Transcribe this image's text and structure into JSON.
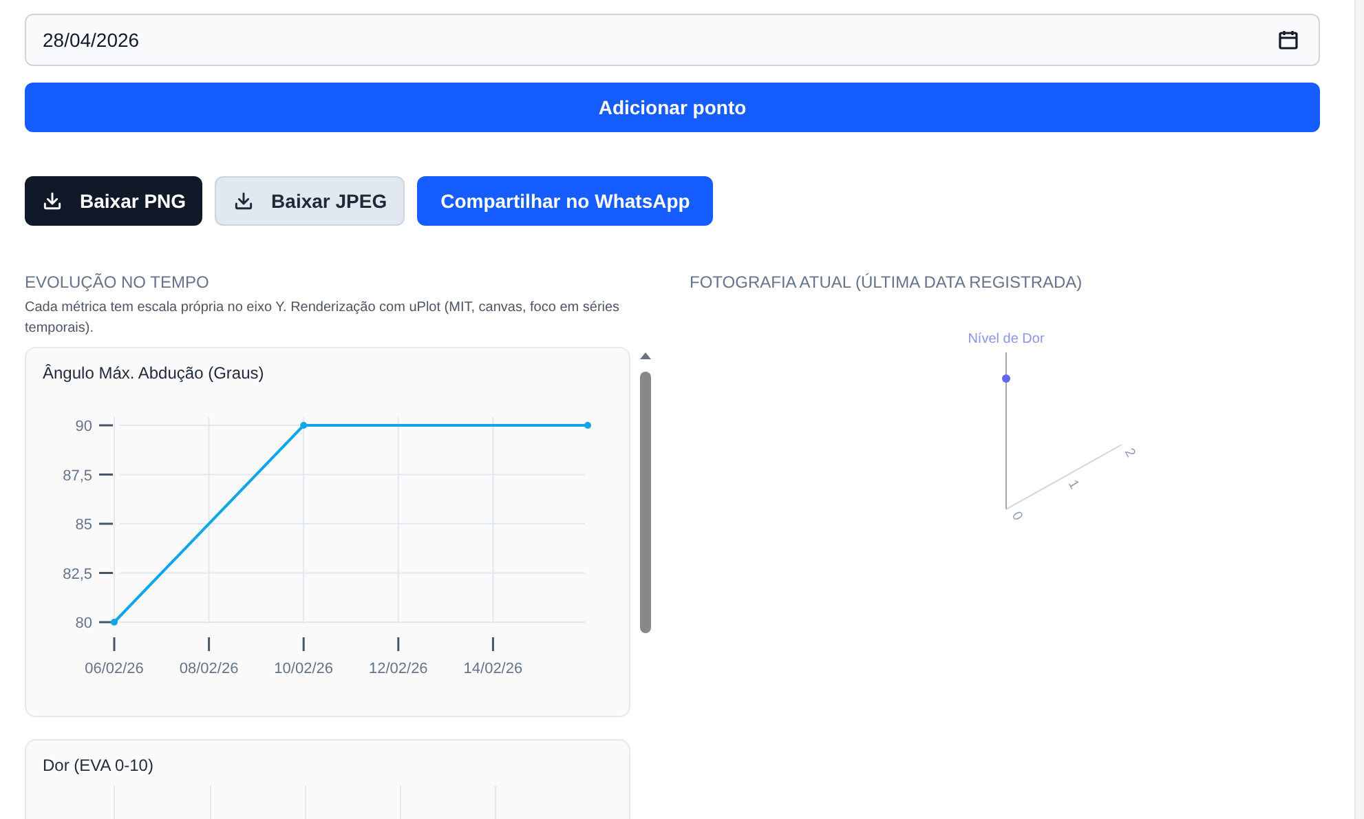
{
  "date_field": {
    "value": "28/04/2026"
  },
  "add_button": {
    "label": "Adicionar ponto"
  },
  "export_buttons": [
    {
      "label": "Baixar PNG",
      "kind": "dark"
    },
    {
      "label": "Baixar JPEG",
      "kind": "light"
    },
    {
      "label": "Compartilhar no WhatsApp",
      "kind": "primary"
    }
  ],
  "evolution": {
    "title": "EVOLUÇÃO NO TEMPO",
    "description": "Cada métrica tem escala própria no eixo Y. Renderização com uPlot (MIT, canvas, foco em séries temporais).",
    "charts": [
      {
        "chart_data": {
          "type": "line",
          "title": "Ângulo Máx. Abdução (Graus)",
          "categories": [
            "06/02/26",
            null,
            "08/02/26",
            null,
            "10/02/26",
            null,
            "12/02/26",
            null,
            "14/02/26",
            null,
            null
          ],
          "yticks": [
            {
              "value": 80,
              "label": "80"
            },
            {
              "value": 82.5,
              "label": "82,5"
            },
            {
              "value": 85,
              "label": "85"
            },
            {
              "value": 87.5,
              "label": "87,5"
            },
            {
              "value": 90,
              "label": "90"
            }
          ],
          "ylim": [
            80,
            90
          ],
          "grid": true,
          "series": [
            {
              "color": "#0ea5e9",
              "marker": true,
              "values": [
                80,
                null,
                null,
                null,
                90,
                null,
                null,
                null,
                null,
                null,
                90
              ]
            }
          ]
        }
      },
      {
        "title": "Dor (EVA 0-10)"
      }
    ]
  },
  "snapshot": {
    "title": "FOTOGRAFIA ATUAL (ÚLTIMA DATA REGISTRADA)",
    "axis_label": "Nível de Dor",
    "ticks": [
      "0",
      "1",
      "2"
    ]
  }
}
